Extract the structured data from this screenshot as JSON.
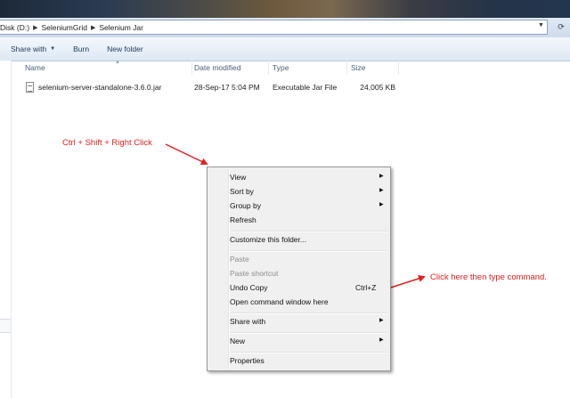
{
  "address": {
    "crumbs": [
      "Disk (D:)",
      "SeleniumGrid",
      "Selenium Jar"
    ]
  },
  "toolbar": {
    "share_with": "Share with",
    "burn": "Burn",
    "new_folder": "New folder"
  },
  "columns": {
    "name": "Name",
    "date_modified": "Date modified",
    "type": "Type",
    "size": "Size"
  },
  "file": {
    "name": "selenium-server-standalone-3.6.0.jar",
    "date_modified": "28-Sep-17 5:04 PM",
    "type": "Executable Jar File",
    "size": "24,005 KB"
  },
  "annotations": {
    "right_click": "Ctrl + Shift + Right Click",
    "command": "Click here then type command.",
    "color": "#e0201e"
  },
  "context_menu": {
    "view": "View",
    "sort_by": "Sort by",
    "group_by": "Group by",
    "refresh": "Refresh",
    "customize": "Customize this folder...",
    "paste": "Paste",
    "paste_shortcut": "Paste shortcut",
    "undo_copy": "Undo Copy",
    "undo_copy_shortcut": "Ctrl+Z",
    "open_command_window": "Open command window here",
    "share_with": "Share with",
    "new": "New",
    "properties": "Properties"
  }
}
